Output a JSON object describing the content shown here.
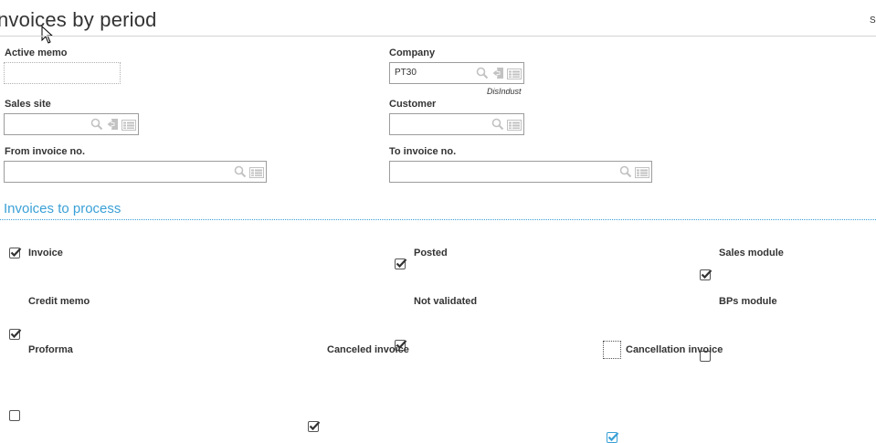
{
  "header": {
    "title": "nvoices by period",
    "corner_text": "S"
  },
  "fields": {
    "active_memo": {
      "label": "Active memo",
      "value": ""
    },
    "company": {
      "label": "Company",
      "value": "PT30",
      "description": "DisIndust"
    },
    "sales_site": {
      "label": "Sales site",
      "value": ""
    },
    "customer": {
      "label": "Customer",
      "value": ""
    },
    "from_invoice": {
      "label": "From invoice no.",
      "value": ""
    },
    "to_invoice": {
      "label": "To invoice no.",
      "value": ""
    }
  },
  "section": {
    "title": "Invoices to process"
  },
  "checkboxes": {
    "invoice": {
      "label": "Invoice",
      "checked": true
    },
    "posted": {
      "label": "Posted",
      "checked": true
    },
    "sales_module": {
      "label": "Sales module",
      "checked": true
    },
    "credit_memo": {
      "label": "Credit memo",
      "checked": true
    },
    "not_validated": {
      "label": "Not validated",
      "checked": true
    },
    "bps_module": {
      "label": "BPs module",
      "checked": false
    },
    "proforma": {
      "label": "Proforma",
      "checked": false
    },
    "canceled_invoice": {
      "label": "Canceled invoice",
      "checked": true
    },
    "cancellation_invoice": {
      "label": "Cancellation invoice",
      "checked": true
    }
  },
  "icons": [
    "search-icon",
    "lookup-icon",
    "list-icon",
    "check-icon",
    "mouse-cursor-icon"
  ],
  "colors": {
    "accent": "#3aa0d6",
    "text": "#333333",
    "border": "#9c9c9c"
  }
}
